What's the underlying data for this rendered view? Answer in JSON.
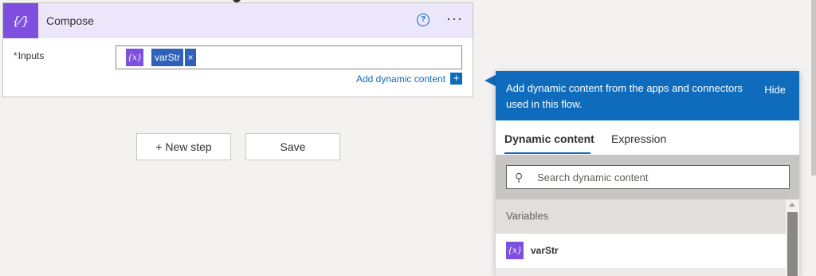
{
  "compose": {
    "title": "Compose",
    "icon_text": "{⁄}",
    "help_icon": "?",
    "more_icon": "···",
    "inputs_required_mark": "*",
    "inputs_label": "Inputs",
    "token": {
      "icon_text": "{x}",
      "label": "varStr",
      "remove": "×"
    },
    "add_dynamic_label": "Add dynamic content",
    "add_dynamic_icon": "+"
  },
  "buttons": {
    "new_step": "+ New step",
    "save": "Save"
  },
  "flyout": {
    "header_text": "Add dynamic content from the apps and connectors used in this flow.",
    "hide_label": "Hide",
    "tabs": [
      {
        "label": "Dynamic content",
        "active": true
      },
      {
        "label": "Expression",
        "active": false
      }
    ],
    "search_placeholder": "Search dynamic content",
    "search_icon": "⚲",
    "section_title": "Variables",
    "items": [
      {
        "icon_text": "{x}",
        "name": "varStr"
      }
    ]
  },
  "colors": {
    "accent_blue": "#0f6cbd",
    "variable_purple": "#7f50e0",
    "header_lavender": "#ece6fb"
  }
}
